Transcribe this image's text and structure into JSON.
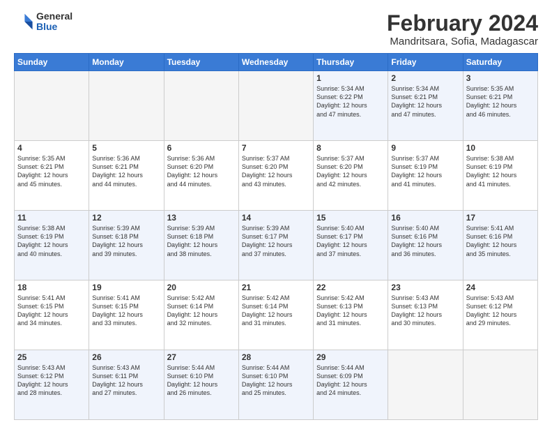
{
  "header": {
    "logo": {
      "general": "General",
      "blue": "Blue"
    },
    "title": "February 2024",
    "subtitle": "Mandritsara, Sofia, Madagascar"
  },
  "calendar": {
    "days_of_week": [
      "Sunday",
      "Monday",
      "Tuesday",
      "Wednesday",
      "Thursday",
      "Friday",
      "Saturday"
    ],
    "weeks": [
      [
        {
          "day": "",
          "info": ""
        },
        {
          "day": "",
          "info": ""
        },
        {
          "day": "",
          "info": ""
        },
        {
          "day": "",
          "info": ""
        },
        {
          "day": "1",
          "info": "Sunrise: 5:34 AM\nSunset: 6:22 PM\nDaylight: 12 hours\nand 47 minutes."
        },
        {
          "day": "2",
          "info": "Sunrise: 5:34 AM\nSunset: 6:21 PM\nDaylight: 12 hours\nand 47 minutes."
        },
        {
          "day": "3",
          "info": "Sunrise: 5:35 AM\nSunset: 6:21 PM\nDaylight: 12 hours\nand 46 minutes."
        }
      ],
      [
        {
          "day": "4",
          "info": "Sunrise: 5:35 AM\nSunset: 6:21 PM\nDaylight: 12 hours\nand 45 minutes."
        },
        {
          "day": "5",
          "info": "Sunrise: 5:36 AM\nSunset: 6:21 PM\nDaylight: 12 hours\nand 44 minutes."
        },
        {
          "day": "6",
          "info": "Sunrise: 5:36 AM\nSunset: 6:20 PM\nDaylight: 12 hours\nand 44 minutes."
        },
        {
          "day": "7",
          "info": "Sunrise: 5:37 AM\nSunset: 6:20 PM\nDaylight: 12 hours\nand 43 minutes."
        },
        {
          "day": "8",
          "info": "Sunrise: 5:37 AM\nSunset: 6:20 PM\nDaylight: 12 hours\nand 42 minutes."
        },
        {
          "day": "9",
          "info": "Sunrise: 5:37 AM\nSunset: 6:19 PM\nDaylight: 12 hours\nand 41 minutes."
        },
        {
          "day": "10",
          "info": "Sunrise: 5:38 AM\nSunset: 6:19 PM\nDaylight: 12 hours\nand 41 minutes."
        }
      ],
      [
        {
          "day": "11",
          "info": "Sunrise: 5:38 AM\nSunset: 6:19 PM\nDaylight: 12 hours\nand 40 minutes."
        },
        {
          "day": "12",
          "info": "Sunrise: 5:39 AM\nSunset: 6:18 PM\nDaylight: 12 hours\nand 39 minutes."
        },
        {
          "day": "13",
          "info": "Sunrise: 5:39 AM\nSunset: 6:18 PM\nDaylight: 12 hours\nand 38 minutes."
        },
        {
          "day": "14",
          "info": "Sunrise: 5:39 AM\nSunset: 6:17 PM\nDaylight: 12 hours\nand 37 minutes."
        },
        {
          "day": "15",
          "info": "Sunrise: 5:40 AM\nSunset: 6:17 PM\nDaylight: 12 hours\nand 37 minutes."
        },
        {
          "day": "16",
          "info": "Sunrise: 5:40 AM\nSunset: 6:16 PM\nDaylight: 12 hours\nand 36 minutes."
        },
        {
          "day": "17",
          "info": "Sunrise: 5:41 AM\nSunset: 6:16 PM\nDaylight: 12 hours\nand 35 minutes."
        }
      ],
      [
        {
          "day": "18",
          "info": "Sunrise: 5:41 AM\nSunset: 6:15 PM\nDaylight: 12 hours\nand 34 minutes."
        },
        {
          "day": "19",
          "info": "Sunrise: 5:41 AM\nSunset: 6:15 PM\nDaylight: 12 hours\nand 33 minutes."
        },
        {
          "day": "20",
          "info": "Sunrise: 5:42 AM\nSunset: 6:14 PM\nDaylight: 12 hours\nand 32 minutes."
        },
        {
          "day": "21",
          "info": "Sunrise: 5:42 AM\nSunset: 6:14 PM\nDaylight: 12 hours\nand 31 minutes."
        },
        {
          "day": "22",
          "info": "Sunrise: 5:42 AM\nSunset: 6:13 PM\nDaylight: 12 hours\nand 31 minutes."
        },
        {
          "day": "23",
          "info": "Sunrise: 5:43 AM\nSunset: 6:13 PM\nDaylight: 12 hours\nand 30 minutes."
        },
        {
          "day": "24",
          "info": "Sunrise: 5:43 AM\nSunset: 6:12 PM\nDaylight: 12 hours\nand 29 minutes."
        }
      ],
      [
        {
          "day": "25",
          "info": "Sunrise: 5:43 AM\nSunset: 6:12 PM\nDaylight: 12 hours\nand 28 minutes."
        },
        {
          "day": "26",
          "info": "Sunrise: 5:43 AM\nSunset: 6:11 PM\nDaylight: 12 hours\nand 27 minutes."
        },
        {
          "day": "27",
          "info": "Sunrise: 5:44 AM\nSunset: 6:10 PM\nDaylight: 12 hours\nand 26 minutes."
        },
        {
          "day": "28",
          "info": "Sunrise: 5:44 AM\nSunset: 6:10 PM\nDaylight: 12 hours\nand 25 minutes."
        },
        {
          "day": "29",
          "info": "Sunrise: 5:44 AM\nSunset: 6:09 PM\nDaylight: 12 hours\nand 24 minutes."
        },
        {
          "day": "",
          "info": ""
        },
        {
          "day": "",
          "info": ""
        }
      ]
    ]
  }
}
